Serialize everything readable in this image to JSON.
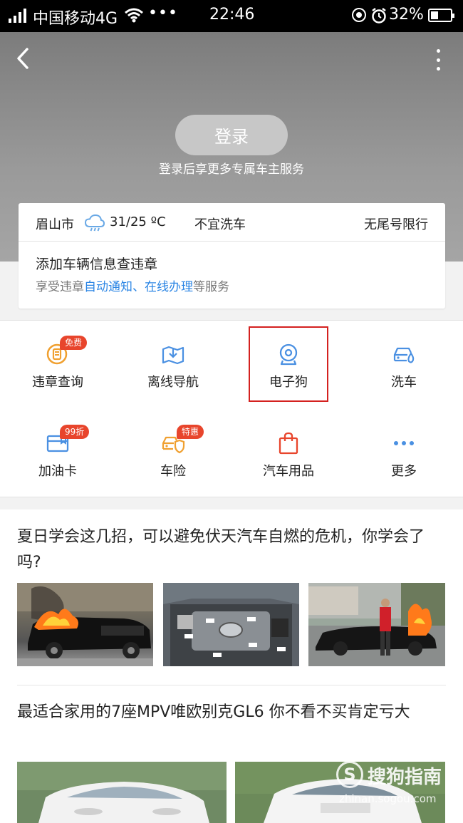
{
  "status_bar": {
    "carrier": "中国移动4G",
    "dots": "•••",
    "time": "22:46",
    "battery": "32%"
  },
  "header": {
    "login_label": "登录",
    "login_subtitle": "登录后享更多专属车主服务"
  },
  "info_card": {
    "city": "眉山市",
    "weather_icon": "cloud-rain-icon",
    "temperature": "31/25 ºC",
    "wash_advice": "不宜洗车",
    "restriction": "无尾号限行",
    "add_vehicle": "添加车辆信息查违章",
    "enjoy_prefix": "享受违章",
    "enjoy_link1": "自动通知",
    "enjoy_sep": "、",
    "enjoy_link2": "在线办理",
    "enjoy_suffix": "等服务",
    "link_color": "#2b85e4"
  },
  "services": [
    {
      "label": "违章查询",
      "icon": "violation-query-icon",
      "badge": "免费"
    },
    {
      "label": "离线导航",
      "icon": "offline-map-icon"
    },
    {
      "label": "电子狗",
      "icon": "camera-dog-icon"
    },
    {
      "label": "洗车",
      "icon": "car-wash-icon"
    },
    {
      "label": "加油卡",
      "icon": "fuel-card-icon",
      "badge": "99折"
    },
    {
      "label": "车险",
      "icon": "car-insurance-icon",
      "badge": "特惠"
    },
    {
      "label": "汽车用品",
      "icon": "shopping-bag-icon"
    },
    {
      "label": "更多",
      "icon": "more-dots-icon"
    }
  ],
  "highlight_color": "#d4211f",
  "articles": [
    {
      "title": "夏日学会这几招，可以避免伏天汽车自燃的危机，你学会了吗?"
    },
    {
      "title": "最适合家用的7座MPV唯欧别克GL6 你不看不买肯定亏大"
    }
  ],
  "watermark": {
    "logo": "S",
    "name": "搜狗指南",
    "url": "zhinan.sogou.com"
  }
}
